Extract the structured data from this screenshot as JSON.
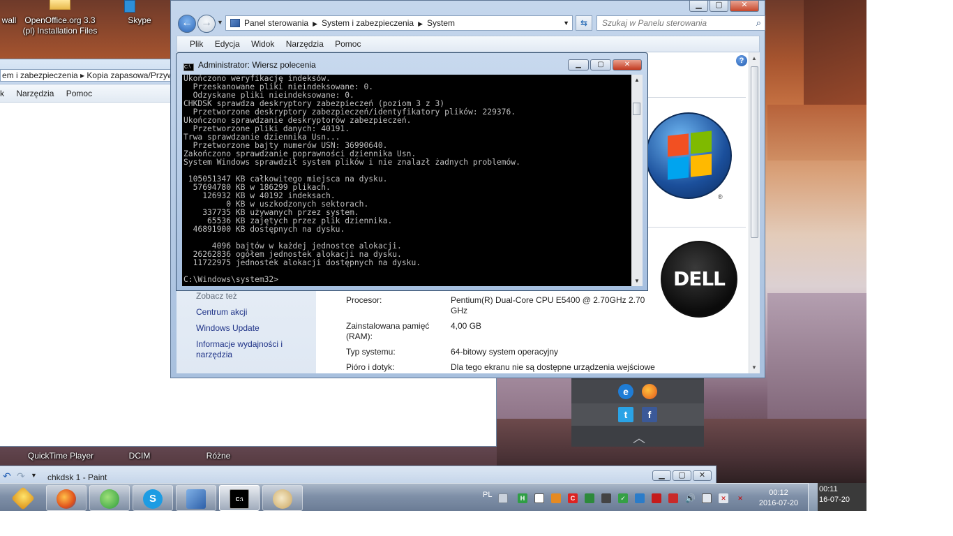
{
  "desktop": {
    "icons": {
      "firewall_label": "wall",
      "openoffice_label": "OpenOffice.org 3.3 (pl) Installation Files",
      "skype_label": "Skype",
      "quicktime_label": "QuickTime Player",
      "dcim_label": "DCIM",
      "rozne_label": "Różne"
    }
  },
  "back_explorer": {
    "address": "em i zabezpieczenia  ▸  Kopia zapasowa/Przyw",
    "menu": [
      "k",
      "Narzędzia",
      "Pomoc"
    ]
  },
  "system_window": {
    "breadcrumb": [
      "Panel sterowania",
      "System i zabezpieczenia",
      "System"
    ],
    "search_placeholder": "Szukaj w Panelu sterowania",
    "menu": [
      "Plik",
      "Edycja",
      "Widok",
      "Narzędzia",
      "Pomoc"
    ],
    "see_also": "Zobacz też",
    "links": [
      "Centrum akcji",
      "Windows Update",
      "Informacje wydajności i narzędzia"
    ],
    "specs": [
      {
        "label": "Procesor:",
        "value": "Pentium(R) Dual-Core  CPU      E5400  @ 2.70GHz   2.70 GHz"
      },
      {
        "label": "Zainstalowana pamięć (RAM):",
        "value": "4,00 GB"
      },
      {
        "label": "Typ systemu:",
        "value": "64-bitowy system operacyjny"
      },
      {
        "label": "Pióro i dotyk:",
        "value": "Dla tego ekranu nie są dostępne urządzenia wejściowe"
      }
    ],
    "help": "?",
    "oem_logo": "DELL"
  },
  "cmd_window": {
    "title": "Administrator: Wiersz polecenia",
    "output": "Ukończono weryfikację indeksów.\n  Przeskanowane pliki nieindeksowane: 0.\n  Odzyskane pliki nieindeksowane: 0.\nCHKDSK sprawdza deskryptory zabezpieczeń (poziom 3 z 3)\n  Przetworzone deskryptory zabezpieczeń/identyfikatory plików: 229376.\nUkończono sprawdzanie deskryptorów zabezpieczeń.\n  Przetworzone pliki danych: 40191.\nTrwa sprawdzanie dziennika Usn...\n  Przetworzone bajty numerów USN: 36990640.\nZakończono sprawdzanie poprawności dziennika Usn.\nSystem Windows sprawdził system plików i nie znalazł żadnych problemów.\n\n 105051347 KB całkowitego miejsca na dysku.\n  57694780 KB w 186299 plikach.\n    126932 KB w 40192 indeksach.\n         0 KB w uszkodzonych sektorach.\n    337735 KB używanych przez system.\n     65536 KB zajętych przez plik dziennika.\n  46891900 KB dostępnych na dysku.\n\n      4096 bajtów w każdej jednostce alokacji.\n  26262836 ogółem jednostek alokacji na dysku.\n  11722975 jednostek alokacji dostępnych na dysku.\n\nC:\\Windows\\system32>"
  },
  "paint_window": {
    "title": "chkdsk 1 - Paint"
  },
  "taskbar": {
    "language": "PL",
    "clock_time": "00:12",
    "clock_date": "2016-07-20",
    "screen2_time": "00:11",
    "screen2_date": "16-07-20"
  },
  "colors": {
    "accent": "#2c66b8",
    "link": "#1e3287",
    "cmd_bg": "#000000",
    "cmd_fg": "#c0c0c0"
  }
}
